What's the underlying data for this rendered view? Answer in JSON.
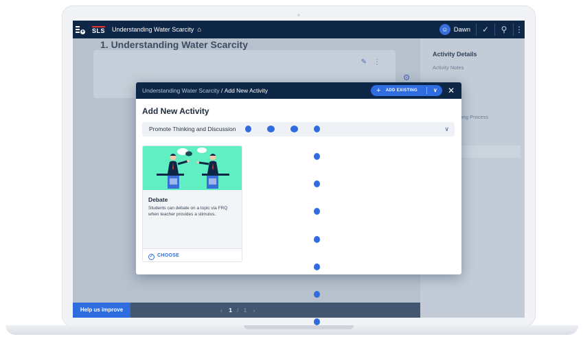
{
  "topbar": {
    "logo": "SLS",
    "lesson_title": "Understanding Water Scarcity",
    "home_icon": "home-outline-icon",
    "user_name": "Dawn",
    "user_icon": "user-avatar-icon",
    "check_icon": "check-circle-icon",
    "share_icon": "share-network-icon",
    "more_icon": "more-vertical-icon"
  },
  "page": {
    "lesson_heading": "1. Understanding Water Scarcity"
  },
  "sidepanel": {
    "title": "Activity Details",
    "notes": "Activity Notes",
    "process_partial": "ing Process"
  },
  "bottombar": {
    "help_label": "Help us improve",
    "page_current": "1",
    "page_sep": "/",
    "page_total": "1"
  },
  "modal": {
    "breadcrumb_parent": "Understanding Water Scarcity",
    "breadcrumb_sep": " / ",
    "breadcrumb_current": "Add New Activity",
    "add_existing_label": "ADD EXISTING",
    "title": "Add New Activity",
    "category_selected": "Promote Thinking and Discussion",
    "card": {
      "title": "Debate",
      "description": "Students can debate on a topic via FRQ when teacher provides a stimulus.",
      "choose_label": "CHOOSE"
    }
  },
  "colors": {
    "navy": "#0f2747",
    "accent_blue": "#2f6ce0",
    "card_image_bg": "#5fefc3"
  }
}
